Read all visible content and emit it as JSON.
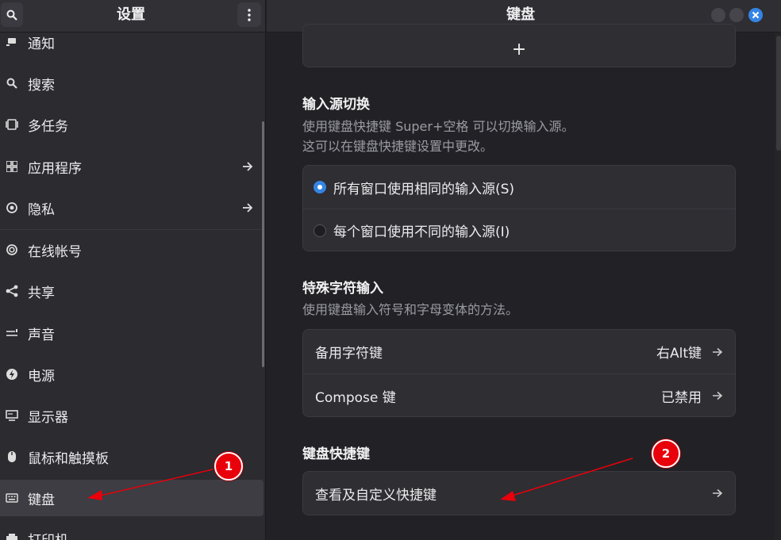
{
  "sidebar": {
    "title": "设置",
    "items": [
      {
        "label": "通知",
        "icon": "notification-icon"
      },
      {
        "label": "搜索",
        "icon": "search-icon"
      },
      {
        "label": "多任务",
        "icon": "multitasking-icon"
      },
      {
        "label": "应用程序",
        "icon": "apps-grid-icon",
        "has_arrow": true
      },
      {
        "label": "隐私",
        "icon": "privacy-icon",
        "has_arrow": true
      },
      {
        "label": "在线帐号",
        "icon": "online-accounts-icon"
      },
      {
        "label": "共享",
        "icon": "share-icon"
      },
      {
        "label": "声音",
        "icon": "sound-icon"
      },
      {
        "label": "电源",
        "icon": "power-icon"
      },
      {
        "label": "显示器",
        "icon": "display-icon"
      },
      {
        "label": "鼠标和触摸板",
        "icon": "mouse-icon"
      },
      {
        "label": "键盘",
        "icon": "keyboard-icon",
        "selected": true
      },
      {
        "label": "打印机",
        "icon": "printer-icon"
      }
    ]
  },
  "main": {
    "title": "键盘",
    "add_button": "+",
    "input_switch": {
      "title": "输入源切换",
      "desc_line1": "使用键盘快捷键 Super+空格 可以切换输入源。",
      "desc_line2": "这可以在键盘快捷键设置中更改。",
      "options": [
        {
          "label": "所有窗口使用相同的输入源(S)",
          "checked": true
        },
        {
          "label": "每个窗口使用不同的输入源(I)",
          "checked": false
        }
      ]
    },
    "special_chars": {
      "title": "特殊字符输入",
      "desc": "使用键盘输入符号和字母变体的方法。",
      "rows": [
        {
          "label": "备用字符键",
          "value": "右Alt键"
        },
        {
          "label": "Compose 键",
          "value": "已禁用"
        }
      ]
    },
    "shortcuts": {
      "title": "键盘快捷键",
      "row_label": "查看及自定义快捷键"
    }
  },
  "annotations": {
    "badge_1": "1",
    "badge_2": "2",
    "color": "#e8000b"
  },
  "colors": {
    "accent": "#3584e4",
    "sidebar_bg": "#2b2b30",
    "main_bg": "#222226"
  }
}
